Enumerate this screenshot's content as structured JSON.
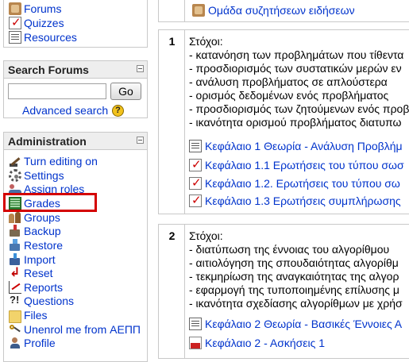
{
  "activities": {
    "items": [
      {
        "label": "Forums",
        "icon": "forum-icon"
      },
      {
        "label": "Quizzes",
        "icon": "quiz-icon"
      },
      {
        "label": "Resources",
        "icon": "resource-icon"
      }
    ]
  },
  "search_forums": {
    "title": "Search Forums",
    "input_value": "",
    "go_label": "Go",
    "advanced_label": "Advanced search",
    "help_glyph": "?"
  },
  "administration": {
    "title": "Administration",
    "items": [
      {
        "label": "Turn editing on",
        "icon": "pencil-icon"
      },
      {
        "label": "Settings",
        "icon": "settings-icon"
      },
      {
        "label": "Assign roles",
        "icon": "roles-icon"
      },
      {
        "label": "Grades",
        "icon": "grades-icon"
      },
      {
        "label": "Groups",
        "icon": "groups-icon"
      },
      {
        "label": "Backup",
        "icon": "backup-icon"
      },
      {
        "label": "Restore",
        "icon": "restore-icon"
      },
      {
        "label": "Import",
        "icon": "import-icon"
      },
      {
        "label": "Reset",
        "icon": "reset-icon"
      },
      {
        "label": "Reports",
        "icon": "reports-icon"
      },
      {
        "label": "Questions",
        "icon": "questions-icon"
      },
      {
        "label": "Files",
        "icon": "folder-icon"
      },
      {
        "label": "Unenrol me from ΑΕΠΠ",
        "icon": "unenrol-icon"
      },
      {
        "label": "Profile",
        "icon": "profile-icon"
      }
    ]
  },
  "top_section": {
    "news_forum": "Ομάδα συζητήσεων ειδήσεων"
  },
  "sections": [
    {
      "number": "1",
      "heading": "Στόχοι:",
      "lines": [
        "- κατανόηση των προβλημάτων που τίθεντα",
        "- προσδιορισμός των συστατικών μερών εν",
        "- ανάλυση προβλήματος σε απλούστερα",
        "- ορισμός δεδομένων ενός προβλήματος",
        "- προσδιορισμός των ζητούμενων ενός προβ",
        "- ικανότητα ορισμού προβλήματος διατυπω"
      ],
      "resources": [
        {
          "label": "Κεφάλαιο 1 Θεωρία - Ανάλυση Προβλήμ",
          "icon": "document-icon"
        },
        {
          "label": "Κεφάλαιο 1.1 Ερωτήσεις του τύπου σωσ",
          "icon": "quiz-icon"
        },
        {
          "label": "Κεφάλαιο 1.2. Ερωτήσεις του τύπου σω",
          "icon": "quiz-icon"
        },
        {
          "label": "Κεφάλαιο 1.3 Ερωτήσεις συμπλήρωσης",
          "icon": "quiz-icon"
        }
      ]
    },
    {
      "number": "2",
      "heading": "Στόχοι:",
      "lines": [
        "- διατύπωση της έννοιας του αλγορίθμου",
        "- αιτιολόγηση της σπουδαιότητας αλγορίθμ",
        "- τεκμηρίωση της αναγκαιότητας της αλγορ",
        "- εφαρμογή της τυποποιημένης επίλυσης μ",
        "- ικανότητα σχεδίασης αλγορίθμων με χρήσ"
      ],
      "resources": [
        {
          "label": "Κεφάλαιο 2 Θεωρία - Βασικές Έννοιες Α",
          "icon": "document-icon"
        },
        {
          "label": "Κεφάλαιο 2 - Ασκήσεις 1",
          "icon": "pdf-icon"
        }
      ]
    }
  ],
  "colors": {
    "link": "#0033cc",
    "block_header_bg": "#eeeeee",
    "border": "#c9c9c9",
    "highlight": "#d40000"
  }
}
